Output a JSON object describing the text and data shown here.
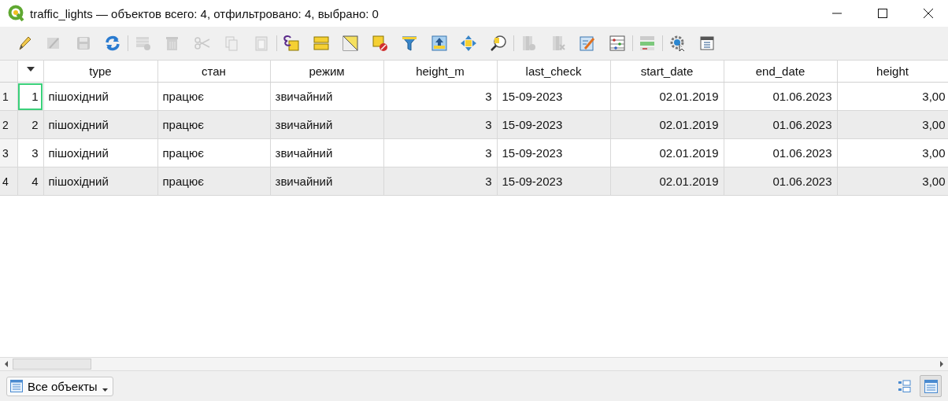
{
  "window": {
    "title": "traffic_lights — объектов всего: 4, отфильтровано: 4, выбрано: 0"
  },
  "toolbar": [
    {
      "kind": "button",
      "disabled": false
    },
    {
      "kind": "button",
      "disabled": true
    },
    {
      "kind": "button",
      "disabled": true
    },
    {
      "kind": "button",
      "disabled": false
    },
    {
      "kind": "separator"
    },
    {
      "kind": "button",
      "disabled": true
    },
    {
      "kind": "button",
      "disabled": true
    },
    {
      "kind": "button",
      "disabled": true
    },
    {
      "kind": "button",
      "disabled": true
    },
    {
      "kind": "button",
      "disabled": true
    },
    {
      "kind": "separator"
    },
    {
      "kind": "button",
      "disabled": false
    },
    {
      "kind": "button",
      "disabled": false
    },
    {
      "kind": "button",
      "disabled": false
    },
    {
      "kind": "button",
      "disabled": false
    },
    {
      "kind": "button",
      "disabled": false
    },
    {
      "kind": "button",
      "disabled": false
    },
    {
      "kind": "button",
      "disabled": false
    },
    {
      "kind": "button",
      "disabled": false
    },
    {
      "kind": "separator"
    },
    {
      "kind": "button",
      "disabled": true
    },
    {
      "kind": "button",
      "disabled": true
    },
    {
      "kind": "button",
      "disabled": false
    },
    {
      "kind": "button",
      "disabled": false
    },
    {
      "kind": "separator"
    },
    {
      "kind": "button",
      "disabled": false
    },
    {
      "kind": "separator"
    },
    {
      "kind": "button",
      "disabled": false
    },
    {
      "kind": "button",
      "disabled": false
    }
  ],
  "table": {
    "columns": [
      {
        "kind": "number",
        "sort_menu": true
      },
      {
        "label": "type",
        "kind": "text"
      },
      {
        "label": "стан",
        "kind": "text"
      },
      {
        "label": "режим",
        "kind": "text"
      },
      {
        "label": "height_m",
        "kind": "number"
      },
      {
        "label": "last_check",
        "kind": "text"
      },
      {
        "label": "start_date",
        "kind": "number"
      },
      {
        "label": "end_date",
        "kind": "number"
      },
      {
        "label": "height",
        "kind": "number"
      }
    ],
    "rows": [
      {
        "number": "1",
        "focused": true,
        "cells": [
          "1",
          "пішохідний",
          "працює",
          "звичайний",
          "3",
          "15-09-2023",
          "02.01.2019",
          "01.06.2023",
          "3,00"
        ]
      },
      {
        "number": "2",
        "focused": false,
        "cells": [
          "2",
          "пішохідний",
          "працює",
          "звичайний",
          "3",
          "15-09-2023",
          "02.01.2019",
          "01.06.2023",
          "3,00"
        ]
      },
      {
        "number": "3",
        "focused": false,
        "cells": [
          "3",
          "пішохідний",
          "працює",
          "звичайний",
          "3",
          "15-09-2023",
          "02.01.2019",
          "01.06.2023",
          "3,00"
        ]
      },
      {
        "number": "4",
        "focused": false,
        "cells": [
          "4",
          "пішохідний",
          "працює",
          "звичайний",
          "3",
          "15-09-2023",
          "02.01.2019",
          "01.06.2023",
          "3,00"
        ]
      }
    ]
  },
  "status_bar": {
    "filter_button": {
      "label": "Все объекты"
    },
    "view_toggles": [
      {
        "selected": false
      },
      {
        "selected": true
      }
    ]
  }
}
